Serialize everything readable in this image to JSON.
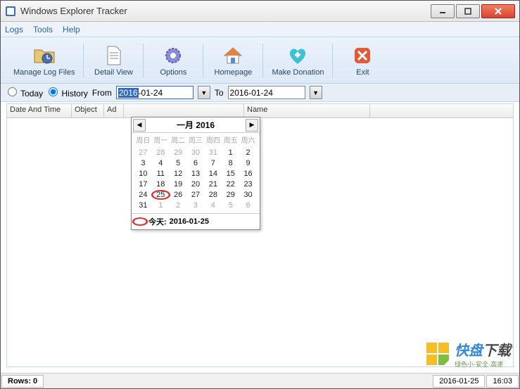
{
  "window": {
    "title": "Windows Explorer Tracker"
  },
  "menu": {
    "logs": "Logs",
    "tools": "Tools",
    "help": "Help"
  },
  "toolbar": {
    "manage": "Manage Log Files",
    "detail": "Detail View",
    "options": "Options",
    "homepage": "Homepage",
    "donate": "Make Donation",
    "exit": "Exit"
  },
  "filter": {
    "today": "Today",
    "history": "History",
    "from": "From",
    "to": "To",
    "from_sel": "2016",
    "from_rest": "-01-24",
    "to_value": "2016-01-24"
  },
  "columns": {
    "c1": "Date And Time",
    "c2": "Object",
    "c3": "Ad",
    "c4": "Name"
  },
  "calendar": {
    "title": "一月 2016",
    "dow": [
      "周日",
      "周一",
      "周二",
      "周三",
      "周四",
      "周五",
      "周六"
    ],
    "weeks": [
      [
        {
          "d": "27",
          "f": 1
        },
        {
          "d": "28",
          "f": 1
        },
        {
          "d": "29",
          "f": 1
        },
        {
          "d": "30",
          "f": 1
        },
        {
          "d": "31",
          "f": 1
        },
        {
          "d": "1"
        },
        {
          "d": "2"
        }
      ],
      [
        {
          "d": "3"
        },
        {
          "d": "4"
        },
        {
          "d": "5"
        },
        {
          "d": "6"
        },
        {
          "d": "7"
        },
        {
          "d": "8"
        },
        {
          "d": "9"
        }
      ],
      [
        {
          "d": "10"
        },
        {
          "d": "11"
        },
        {
          "d": "12"
        },
        {
          "d": "13"
        },
        {
          "d": "14"
        },
        {
          "d": "15"
        },
        {
          "d": "16"
        }
      ],
      [
        {
          "d": "17"
        },
        {
          "d": "18"
        },
        {
          "d": "19"
        },
        {
          "d": "20"
        },
        {
          "d": "21"
        },
        {
          "d": "22"
        },
        {
          "d": "23"
        }
      ],
      [
        {
          "d": "24"
        },
        {
          "d": "25",
          "c": 1
        },
        {
          "d": "26"
        },
        {
          "d": "27"
        },
        {
          "d": "28"
        },
        {
          "d": "29"
        },
        {
          "d": "30"
        }
      ],
      [
        {
          "d": "31"
        },
        {
          "d": "1",
          "f": 1
        },
        {
          "d": "2",
          "f": 1
        },
        {
          "d": "3",
          "f": 1
        },
        {
          "d": "4",
          "f": 1
        },
        {
          "d": "5",
          "f": 1
        },
        {
          "d": "6",
          "f": 1
        }
      ]
    ],
    "today_label": "今天:",
    "today_date": "2016-01-25"
  },
  "status": {
    "rows": "Rows: 0",
    "date": "2016-01-25",
    "time": "16:03"
  },
  "watermark": {
    "brand1": "快盘",
    "brand2": "下载",
    "tag": "绿色小·安全·高速"
  }
}
